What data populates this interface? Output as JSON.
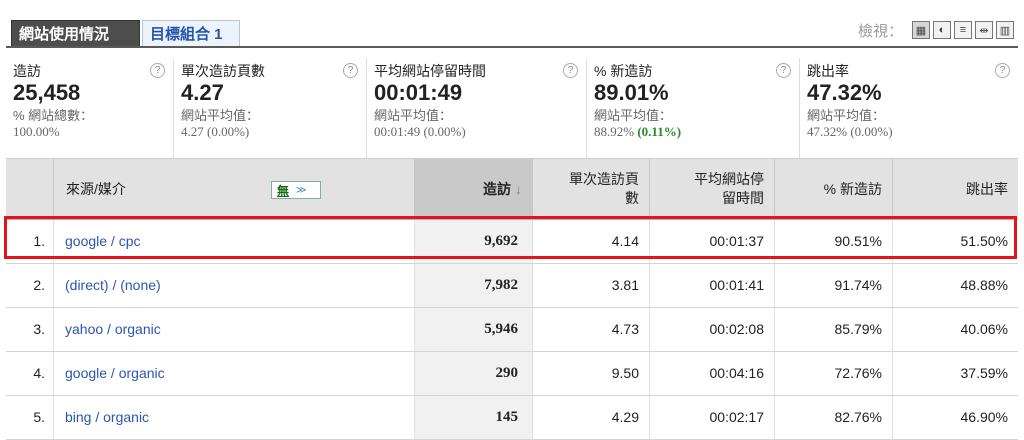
{
  "tabs": [
    {
      "label": "網站使用情況",
      "active": true
    },
    {
      "label": "目標組合 1",
      "active": false
    }
  ],
  "view": {
    "label": "檢視：",
    "buttons": [
      {
        "name": "table-view-icon",
        "glyph": "▦"
      },
      {
        "name": "pie-view-icon",
        "glyph": "◐"
      },
      {
        "name": "bar-view-icon",
        "glyph": "≡"
      },
      {
        "name": "comparison-view-icon",
        "glyph": "⇹"
      },
      {
        "name": "pivot-view-icon",
        "glyph": "▥"
      }
    ]
  },
  "metrics": [
    {
      "name": "造訪",
      "value": "25,458",
      "sub": "% 網站總數：",
      "subval": "100.00%",
      "subval_pos": ""
    },
    {
      "name": "單次造訪頁數",
      "value": "4.27",
      "sub": "網站平均值：",
      "subval": "4.27 (0.00%)",
      "subval_pos": ""
    },
    {
      "name": "平均網站停留時間",
      "value": "00:01:49",
      "sub": "網站平均值：",
      "subval": "00:01:49 (0.00%)",
      "subval_pos": ""
    },
    {
      "name": "% 新造訪",
      "value": "89.01%",
      "sub": "網站平均值：",
      "subval": "88.92% ",
      "subval_pos": "(0.11%)"
    },
    {
      "name": "跳出率",
      "value": "47.32%",
      "sub": "網站平均值：",
      "subval": "47.32% (0.00%)",
      "subval_pos": ""
    }
  ],
  "help_glyph": "?",
  "table": {
    "headers": {
      "source": "來源/媒介",
      "dropdown": "無",
      "dropdown_arrow": "≫",
      "visits": "造訪",
      "sort_arrow": "↓",
      "pages_line1": "單次造訪頁",
      "pages_line2": "數",
      "time_line1": "平均網站停",
      "time_line2": "留時間",
      "new": "% 新造訪",
      "bounce": "跳出率"
    },
    "rows": [
      {
        "idx": "1.",
        "source": "google / cpc",
        "visits": "9,692",
        "pages": "4.14",
        "time": "00:01:37",
        "new": "90.51%",
        "bounce": "51.50%"
      },
      {
        "idx": "2.",
        "source": "(direct) / (none)",
        "visits": "7,982",
        "pages": "3.81",
        "time": "00:01:41",
        "new": "91.74%",
        "bounce": "48.88%"
      },
      {
        "idx": "3.",
        "source": "yahoo / organic",
        "visits": "5,946",
        "pages": "4.73",
        "time": "00:02:08",
        "new": "85.79%",
        "bounce": "40.06%"
      },
      {
        "idx": "4.",
        "source": "google / organic",
        "visits": "290",
        "pages": "9.50",
        "time": "00:04:16",
        "new": "72.76%",
        "bounce": "37.59%"
      },
      {
        "idx": "5.",
        "source": "bing / organic",
        "visits": "145",
        "pages": "4.29",
        "time": "00:02:17",
        "new": "82.76%",
        "bounce": "46.90%"
      }
    ]
  },
  "colors": {
    "highlight": "#e3141a",
    "link": "#2b55b3",
    "positive": "#2a8a2a"
  }
}
